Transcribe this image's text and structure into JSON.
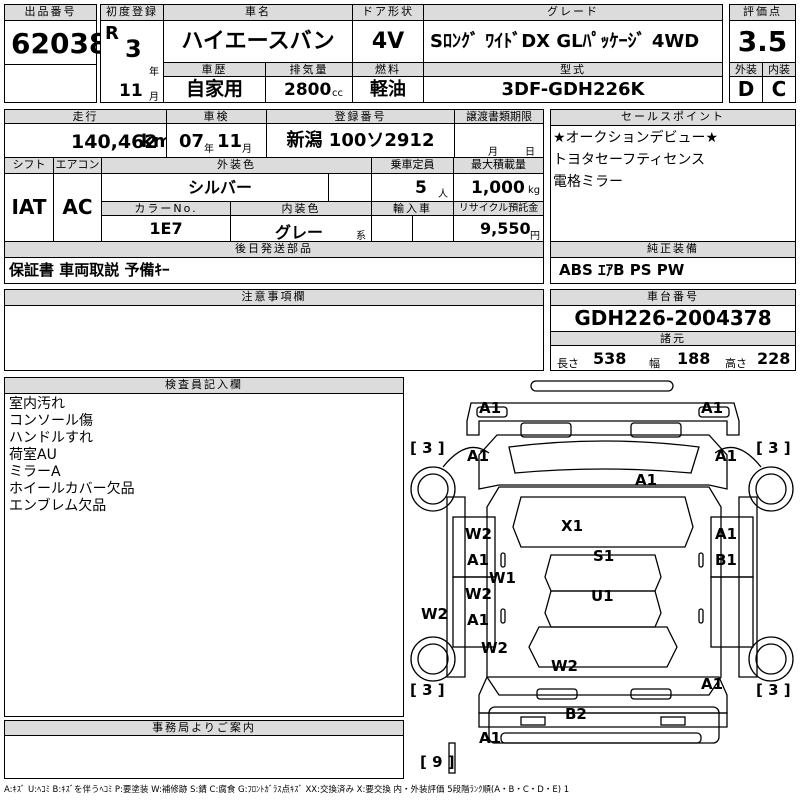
{
  "header": {
    "lot_no_label": "出品番号",
    "lot_no": "62038",
    "first_reg_label": "初度登録",
    "era": "R",
    "year": "3",
    "year_unit": "年",
    "month": "11",
    "month_unit": "月",
    "car_name_label": "車名",
    "car_name": "ハイエースバン",
    "door_label": "ドア形状",
    "door": "4V",
    "grade_label": "グレード",
    "grade": "Sﾛﾝｸﾞ ﾜｲﾄﾞDX GLﾊﾟｯｹｰｼﾞ 4WD",
    "score_label": "評価点",
    "score": "3.5",
    "history_label": "車歴",
    "history": "自家用",
    "displacement_label": "排気量",
    "displacement": "2800",
    "displacement_unit": "cc",
    "fuel_label": "燃料",
    "fuel": "軽油",
    "model_label": "型式",
    "model": "3DF-GDH226K",
    "exterior_label": "外装",
    "exterior": "D",
    "interior_label": "内装",
    "interior": "C"
  },
  "row2": {
    "mileage_label": "走行",
    "mileage": "140,462",
    "mileage_unit": "km",
    "inspection_label": "車検",
    "insp_year": "07",
    "insp_year_unit": "年",
    "insp_month": "11",
    "insp_month_unit": "月",
    "plate_label": "登録番号",
    "plate": "新潟 100ソ2912",
    "deadline_label": "譲渡書類期限",
    "deadline_month": "月",
    "deadline_day": "日",
    "selling_label": "セールスポイント",
    "selling": [
      "★オークションデビュー★",
      "トヨタセーフティセンス",
      "電格ミラー"
    ]
  },
  "row3": {
    "shift_label": "シフト",
    "shift": "IAT",
    "ac_label": "エアコン",
    "ac": "AC",
    "color_label": "外装色",
    "color": "シルバー",
    "capacity_label": "乗車定員",
    "capacity": "5",
    "capacity_unit": "人",
    "load_label": "最大積載量",
    "load": "1,000",
    "load_unit": "kg",
    "color_no_label": "カラーNo.",
    "color_no": "1E7",
    "int_color_label": "内装色",
    "int_color": "グレー",
    "int_color_unit": "系",
    "import_label": "輸入車",
    "recycle_label": "リサイクル預託金",
    "recycle": "9,550",
    "recycle_unit": "円"
  },
  "parts": {
    "label": "後日発送部品",
    "value": "保証書 車両取説 予備ｷｰ",
    "equip_label": "純正装備",
    "equip": "ABS ｴｱB PS PW"
  },
  "notes": {
    "label": "注意事項欄",
    "chassis_label": "車台番号",
    "chassis": "GDH226-2004378",
    "spec_label": "諸元",
    "len_label": "長さ",
    "len": "538",
    "width_label": "幅",
    "width": "188",
    "height_label": "高さ",
    "height": "228"
  },
  "inspector": {
    "label": "検査員記入欄",
    "lines": [
      "室内汚れ",
      "コンソール傷",
      "ハンドルすれ",
      "荷室AU",
      "ミラーA",
      "ホイールカバー欠品",
      "エンブレム欠品"
    ]
  },
  "office": {
    "label": "事務局よりご案内"
  },
  "diagram": {
    "tire_left_front": "[ 3 ]",
    "tire_right_front": "[ 3 ]",
    "tire_left_rear": "[ 3 ]",
    "tire_right_rear": "[ 3 ]",
    "spare": "[ 9 ]",
    "marks": [
      "A1",
      "A1",
      "A1",
      "A1",
      "A1",
      "X1",
      "W2",
      "A1",
      "S1",
      "A1",
      "B1",
      "W1",
      "W2",
      "U1",
      "W2",
      "A1",
      "W2",
      "W2",
      "A1",
      "B2",
      "A1"
    ]
  },
  "legend": "A:ｷｽﾞ U:ﾍｺﾐ B:ｷｽﾞを伴うﾍｺﾐ P:要塗装 W:補修跡 S:錆 C:腐食 G:ﾌﾛﾝﾄｶﾞﾗｽ点ｷｽﾞ XX:交換済み X:要交換  内・外装評価 5段階ﾗﾝｸ順(A・B・C・D・E) 1"
}
